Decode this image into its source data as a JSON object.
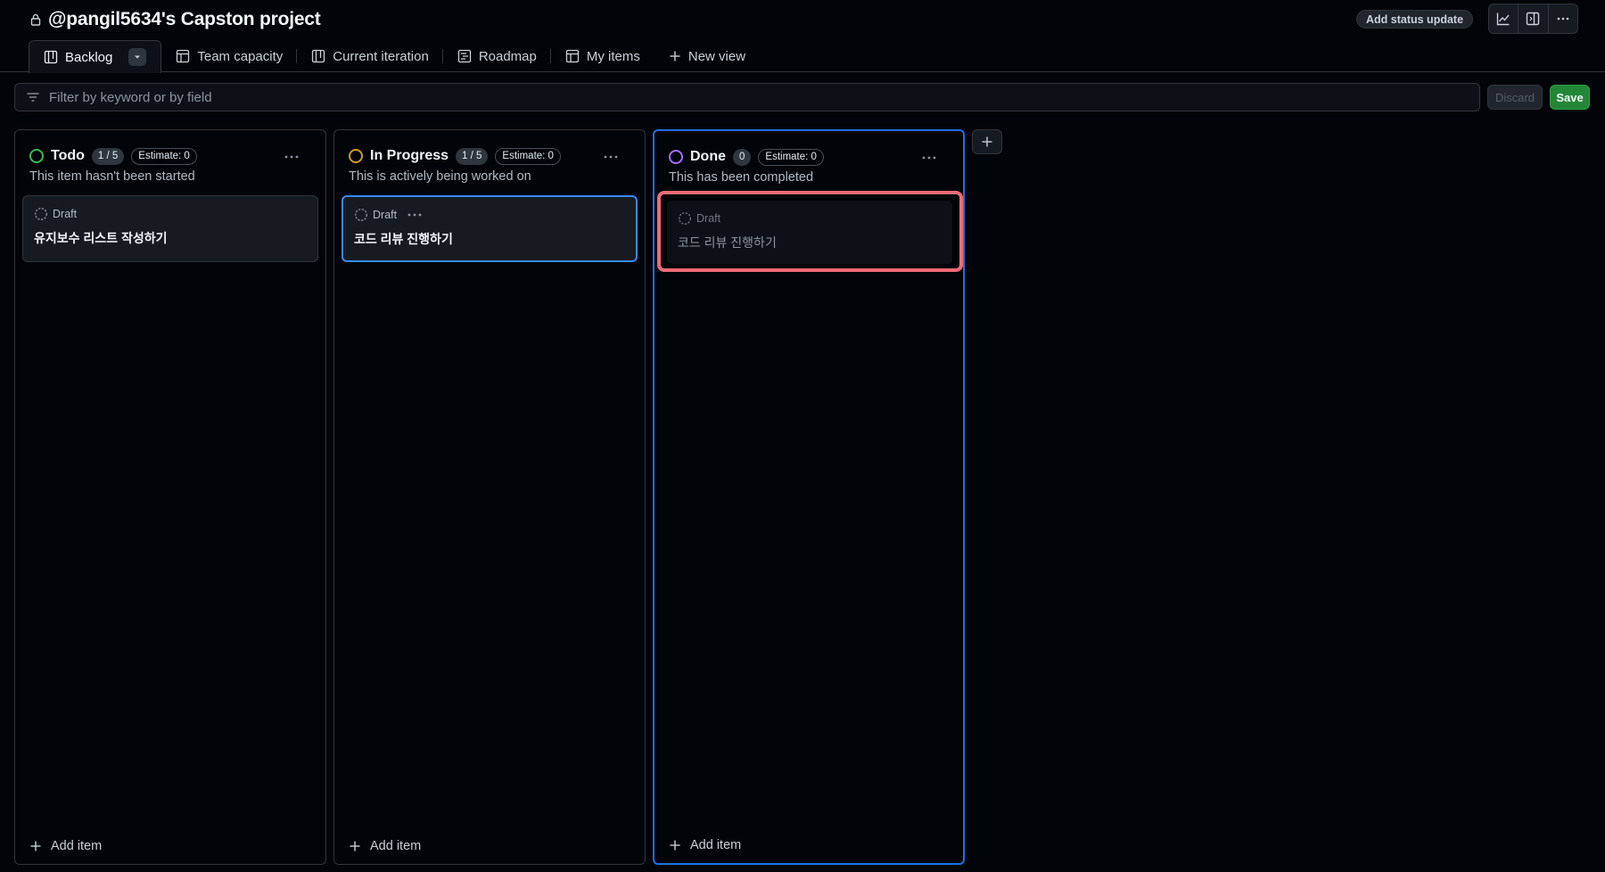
{
  "project": {
    "title": "@pangil5634's Capston project",
    "status_button": "Add status update"
  },
  "header_icons": [
    "insights-graph-icon",
    "side-panel-icon",
    "kebab-menu-icon"
  ],
  "tabs": [
    {
      "label": "Backlog",
      "icon": "board-icon",
      "active": true
    },
    {
      "label": "Team capacity",
      "icon": "table-icon"
    },
    {
      "label": "Current iteration",
      "icon": "board-icon"
    },
    {
      "label": "Roadmap",
      "icon": "roadmap-icon"
    },
    {
      "label": "My items",
      "icon": "table-icon"
    },
    {
      "label": "New view",
      "icon": "plus-icon"
    }
  ],
  "filter": {
    "placeholder": "Filter by keyword or by field",
    "discard_label": "Discard",
    "save_label": "Save"
  },
  "columns": [
    {
      "name": "Todo",
      "count": "1 / 5",
      "estimate": "Estimate: 0",
      "description": "This item hasn't been started",
      "status_color": "#3fb950",
      "cards": [
        {
          "type": "Draft",
          "title": "유지보수 리스트 작성하기"
        }
      ],
      "add_label": "Add item"
    },
    {
      "name": "In Progress",
      "count": "1 / 5",
      "estimate": "Estimate: 0",
      "description": "This is actively being worked on",
      "status_color": "#d29922",
      "cards": [
        {
          "type": "Draft",
          "title": "코드 리뷰 진행하기"
        }
      ],
      "add_label": "Add item"
    },
    {
      "name": "Done",
      "count": "0",
      "estimate": "Estimate: 0",
      "description": "This has been completed",
      "status_color": "#a371f7",
      "cards": [
        {
          "type": "Draft",
          "title": "코드 리뷰 진행하기"
        }
      ],
      "add_label": "Add item"
    }
  ],
  "colors": {
    "background": "#010409",
    "border": "#30363d",
    "accent_blue": "#1f6feb",
    "save_green": "#238636",
    "drop_highlight": "#ee6b78"
  }
}
